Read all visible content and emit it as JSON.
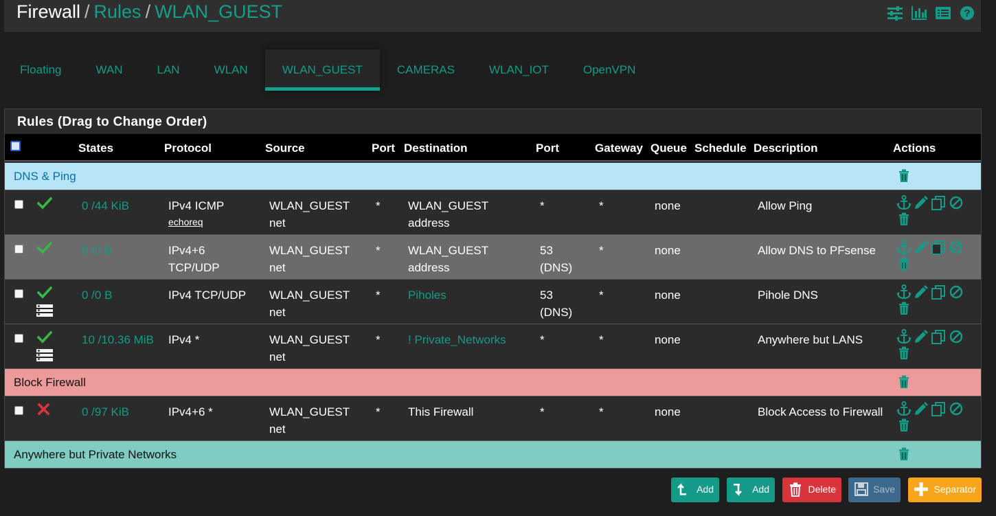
{
  "breadcrumb": {
    "root": "Firewall",
    "sep1": "/",
    "rules": "Rules",
    "sep2": "/",
    "current": "WLAN_GUEST"
  },
  "header_icons": [
    "sliders-icon",
    "bar-chart-icon",
    "list-icon",
    "help-icon"
  ],
  "tabs": [
    {
      "label": "Floating"
    },
    {
      "label": "WAN"
    },
    {
      "label": "LAN"
    },
    {
      "label": "WLAN"
    },
    {
      "label": "WLAN_GUEST",
      "active": true
    },
    {
      "label": "CAMERAS"
    },
    {
      "label": "WLAN_IOT"
    },
    {
      "label": "OpenVPN"
    }
  ],
  "panel": {
    "title": "Rules (Drag to Change Order)"
  },
  "columns": {
    "states": "States",
    "protocol": "Protocol",
    "source": "Source",
    "sport": "Port",
    "destination": "Destination",
    "dport": "Port",
    "gateway": "Gateway",
    "queue": "Queue",
    "schedule": "Schedule",
    "description": "Description",
    "actions": "Actions"
  },
  "rows": [
    {
      "type": "separator",
      "label": "DNS & Ping",
      "bg": "#b7e5f7",
      "fg": "#0b6fa8"
    },
    {
      "type": "rule",
      "status": "pass",
      "states": "0 /44 KiB",
      "protocol": "IPv4 ICMP",
      "protocol_sub": "echoreq",
      "source": "WLAN_GUEST net",
      "sport": "*",
      "destination": "WLAN_GUEST address",
      "dest_link": false,
      "dport": "*",
      "gateway": "*",
      "queue": "none",
      "schedule": "",
      "description": "Allow Ping",
      "bg": "#2b2b2b",
      "queue_icon": false
    },
    {
      "type": "rule",
      "status": "pass",
      "states": "0 /0 B",
      "protocol": "IPv4+6 TCP/UDP",
      "protocol_sub": "",
      "source": "WLAN_GUEST net",
      "sport": "*",
      "destination": "WLAN_GUEST address",
      "dest_link": false,
      "dport": "53 (DNS)",
      "gateway": "*",
      "queue": "none",
      "schedule": "",
      "description": "Allow DNS to PFsense",
      "bg": "#6b6b6b",
      "queue_icon": false
    },
    {
      "type": "rule",
      "status": "pass",
      "states": "0 /0 B",
      "protocol": "IPv4 TCP/UDP",
      "protocol_sub": "",
      "source": "WLAN_GUEST net",
      "sport": "*",
      "destination": "Piholes",
      "dest_link": true,
      "dport": "53 (DNS)",
      "gateway": "*",
      "queue": "none",
      "schedule": "",
      "description": "Pihole DNS",
      "bg": "#2b2b2b",
      "queue_icon": true
    },
    {
      "type": "rule",
      "status": "pass",
      "states": "10 /10.36 MiB",
      "protocol": "IPv4 *",
      "protocol_sub": "",
      "source": "WLAN_GUEST net",
      "sport": "*",
      "destination": "! Private_Networks",
      "dest_link": true,
      "dport": "*",
      "gateway": "*",
      "queue": "none",
      "schedule": "",
      "description": "Anywhere but LANS",
      "bg": "#2b2b2b",
      "queue_icon": true
    },
    {
      "type": "separator",
      "label": "Block Firewall",
      "bg": "#ec9a9a",
      "fg": "#111111"
    },
    {
      "type": "rule",
      "status": "block",
      "states": "0 /97 KiB",
      "protocol": "IPv4+6 *",
      "protocol_sub": "",
      "source": "WLAN_GUEST net",
      "sport": "*",
      "destination": "This Firewall",
      "dest_link": false,
      "dport": "*",
      "gateway": "*",
      "queue": "none",
      "schedule": "",
      "description": "Block Access to Firewall",
      "bg": "#2b2b2b",
      "queue_icon": false
    },
    {
      "type": "separator",
      "label": "Anywhere but Private Networks",
      "bg": "#7fcdc2",
      "fg": "#111111"
    }
  ],
  "buttons": [
    {
      "label": "Add",
      "icon": "add-top-icon",
      "bg": "#149a87"
    },
    {
      "label": "Add",
      "icon": "add-bottom-icon",
      "bg": "#149a87"
    },
    {
      "label": "Delete",
      "icon": "trash-icon",
      "bg": "#d8343c"
    },
    {
      "label": "Save",
      "icon": "save-icon",
      "bg": "#3d6a8c"
    },
    {
      "label": "Separator",
      "icon": "plus-icon",
      "bg": "#f7a51b"
    }
  ],
  "colors": {
    "accent": "#149a87",
    "pass": "#3ab54a",
    "block": "#d8343c"
  }
}
